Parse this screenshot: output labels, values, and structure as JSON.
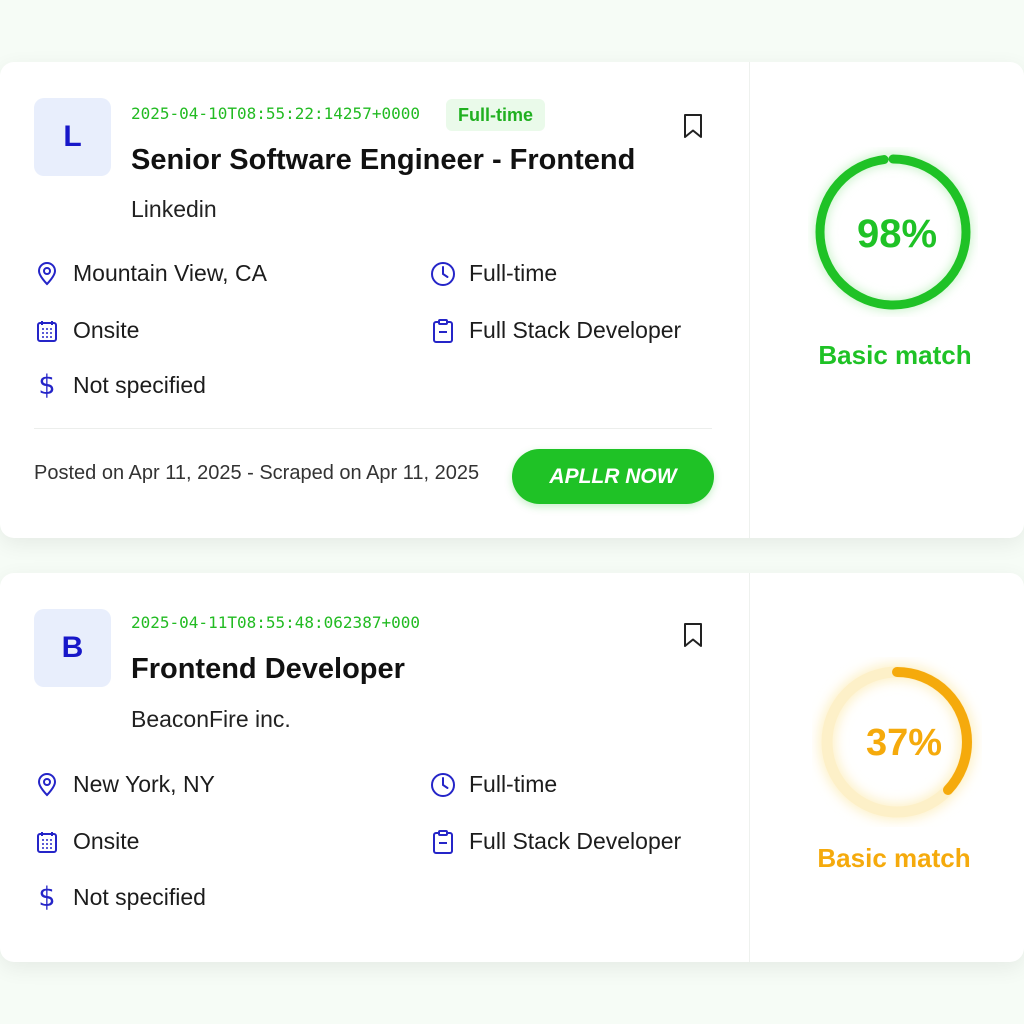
{
  "colors": {
    "accent_green": "#1fc226",
    "accent_orange": "#f5aa0c",
    "brand_blue": "#2525c8"
  },
  "jobs": [
    {
      "logo_letter": "L",
      "timestamp": "2025-04-10T08:55:22:14257+0000",
      "badge": "Full-time",
      "title": "Senior Software Engineer - Frontend",
      "company": "Linkedin",
      "location": "Mountain View, CA",
      "job_type": "Full-time",
      "workplace": "Onsite",
      "role": "Full Stack Developer",
      "salary_symbol": "$",
      "salary": "Not specified",
      "posted": "Posted on Apr 11, 2025 - Scraped on Apr 11, 2025",
      "apply_label": "APLLR NOW",
      "match_percent": 98,
      "match_text": "98%",
      "match_label": "Basic match",
      "match_color": "#1fc226"
    },
    {
      "logo_letter": "B",
      "timestamp": "2025-04-11T08:55:48:062387+000",
      "title": "Frontend Developer",
      "company": "BeaconFire inc.",
      "location": "New York, NY",
      "job_type": "Full-time",
      "workplace": "Onsite",
      "role": "Full Stack Developer",
      "salary_symbol": "$",
      "salary": "Not specified",
      "match_percent": 37,
      "match_text": "37%",
      "match_label": "Basic match",
      "match_color": "#f5aa0c"
    }
  ],
  "icons": {
    "location": "map-pin-icon",
    "job_type": "clock-icon",
    "workplace": "building-icon",
    "role": "clipboard-icon",
    "salary": "dollar-icon",
    "save": "bookmark-icon"
  }
}
